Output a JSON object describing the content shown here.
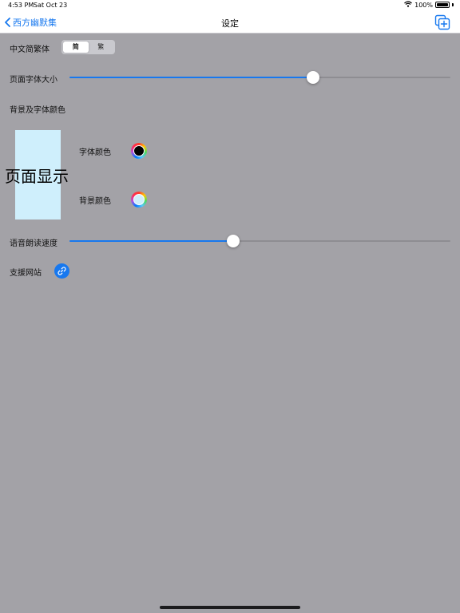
{
  "status_bar": {
    "time": "4:53 PM",
    "date": "Sat Oct 23",
    "battery": "100%"
  },
  "nav": {
    "back_label": "西方幽默集",
    "title": "设定"
  },
  "script_toggle": {
    "label": "中文简繁体",
    "options": [
      "简",
      "繁"
    ],
    "selected": "简"
  },
  "font_size": {
    "label": "页面字体大小",
    "value_fraction": 0.64
  },
  "colors": {
    "label": "背景及字体颜色",
    "preview_text": "页面显示",
    "font_color_label": "字体颜色",
    "font_color": "#000000",
    "background_color_label": "背景颜色",
    "background_color": "#cfeffc"
  },
  "speech_rate": {
    "label": "语音朗读速度",
    "value_fraction": 0.43
  },
  "support_site": {
    "label": "支援网站",
    "icon": "link-icon"
  },
  "accent_color": "#1778ef"
}
